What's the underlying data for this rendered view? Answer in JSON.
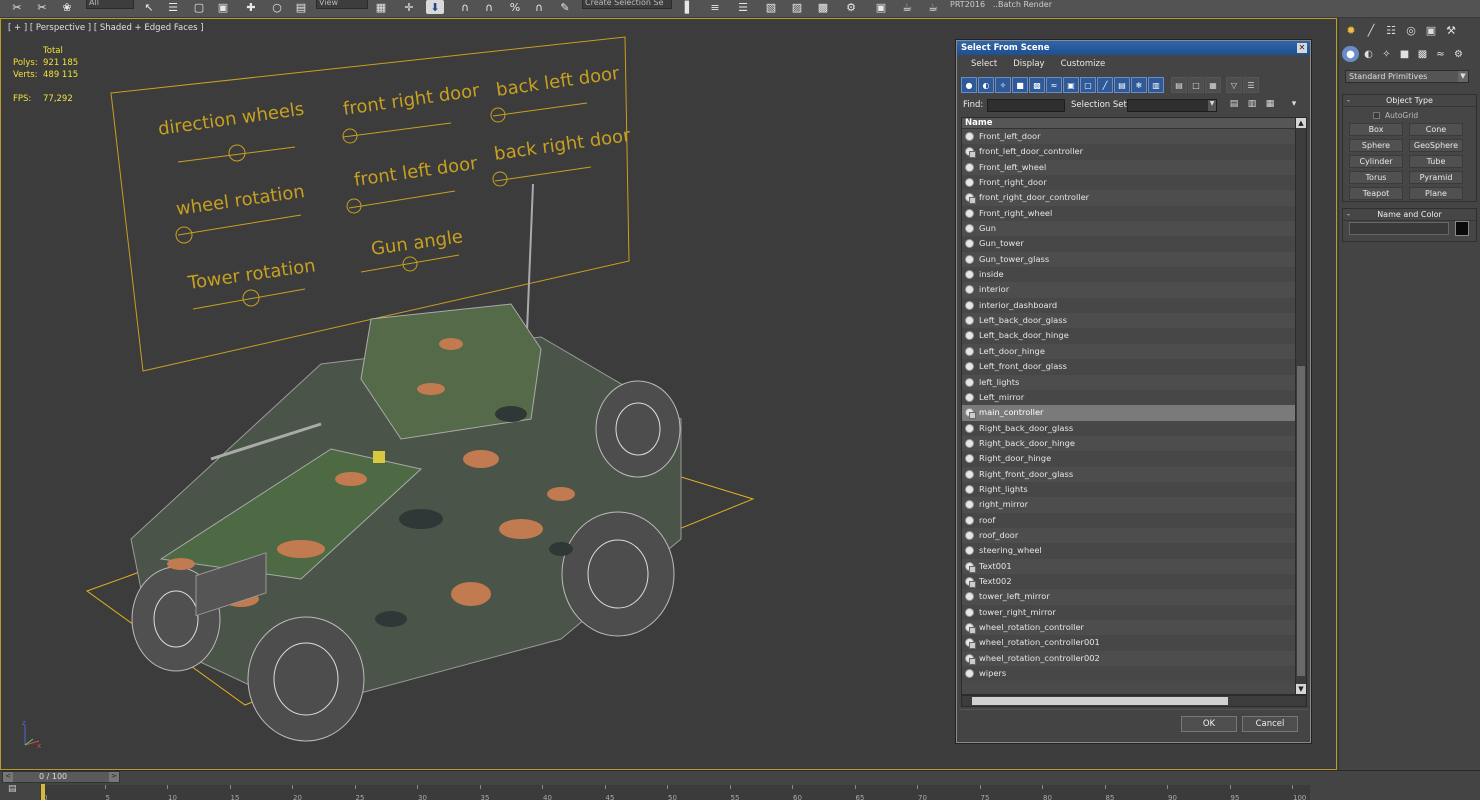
{
  "toolbar": {
    "filter_value": "All",
    "refcoord_value": "View",
    "named_selection": "Create Selection Se",
    "plugin_label": "PRT2016",
    "batch_render": "Batch Render..."
  },
  "viewport": {
    "label": "[ + ] [ Perspective ] [ Shaded + Edged Faces ]",
    "stats": {
      "total_label": "Total",
      "polys_label": "Polys:",
      "polys_value": "921 185",
      "verts_label": "Verts:",
      "verts_value": "489 115",
      "fps_label": "FPS:",
      "fps_value": "77,292"
    },
    "panel_labels": {
      "direction_wheels": "direction wheels",
      "front_right_door": "front right door",
      "back_left_door": "back left door",
      "wheel_rotation": "wheel rotation",
      "front_left_door": "front left door",
      "back_right_door": "back right door",
      "tower_rotation": "Tower rotation",
      "gun_angle": "Gun angle"
    },
    "colors": {
      "panel": "#c8a020",
      "selection": "#e0b020",
      "wire": "#bdbdbd",
      "camo_green": "#5e7a4a",
      "camo_orange": "#c27a50",
      "camo_dark": "#3c4640"
    }
  },
  "command_panel": {
    "primitive_type": "Standard Primitives",
    "object_type_title": "Object Type",
    "autogrid_label": "AutoGrid",
    "buttons": [
      "Box",
      "Cone",
      "Sphere",
      "GeoSphere",
      "Cylinder",
      "Tube",
      "Torus",
      "Pyramid",
      "Teapot",
      "Plane"
    ],
    "name_color_title": "Name and Color"
  },
  "dialog": {
    "title": "Select From Scene",
    "menu": [
      "Select",
      "Display",
      "Customize"
    ],
    "find_label": "Find:",
    "selection_set_label": "Selection Set:",
    "column_header": "Name",
    "items": [
      {
        "name": "Front_left_door",
        "helper": false
      },
      {
        "name": "front_left_door_controller",
        "helper": true
      },
      {
        "name": "Front_left_wheel",
        "helper": false
      },
      {
        "name": "Front_right_door",
        "helper": false
      },
      {
        "name": "front_right_door_controller",
        "helper": true
      },
      {
        "name": "Front_right_wheel",
        "helper": false
      },
      {
        "name": "Gun",
        "helper": false
      },
      {
        "name": "Gun_tower",
        "helper": false
      },
      {
        "name": "Gun_tower_glass",
        "helper": false
      },
      {
        "name": "inside",
        "helper": false
      },
      {
        "name": "interior",
        "helper": false
      },
      {
        "name": "interior_dashboard",
        "helper": false
      },
      {
        "name": "Left_back_door_glass",
        "helper": false
      },
      {
        "name": "Left_back_door_hinge",
        "helper": false
      },
      {
        "name": "Left_door_hinge",
        "helper": false
      },
      {
        "name": "Left_front_door_glass",
        "helper": false
      },
      {
        "name": "left_lights",
        "helper": false
      },
      {
        "name": "Left_mirror",
        "helper": false
      },
      {
        "name": "main_controller",
        "helper": true,
        "selected": true
      },
      {
        "name": "Right_back_door_glass",
        "helper": false
      },
      {
        "name": "Right_back_door_hinge",
        "helper": false
      },
      {
        "name": "Right_door_hinge",
        "helper": false
      },
      {
        "name": "Right_front_door_glass",
        "helper": false
      },
      {
        "name": "Right_lights",
        "helper": false
      },
      {
        "name": "right_mirror",
        "helper": false
      },
      {
        "name": "roof",
        "helper": false
      },
      {
        "name": "roof_door",
        "helper": false
      },
      {
        "name": "steering_wheel",
        "helper": false
      },
      {
        "name": "Text001",
        "helper": true
      },
      {
        "name": "Text002",
        "helper": true
      },
      {
        "name": "tower_left_mirror",
        "helper": false
      },
      {
        "name": "tower_right_mirror",
        "helper": false
      },
      {
        "name": "wheel_rotation_controller",
        "helper": true
      },
      {
        "name": "wheel_rotation_controller001",
        "helper": true
      },
      {
        "name": "wheel_rotation_controller002",
        "helper": true
      },
      {
        "name": "wipers",
        "helper": false
      }
    ],
    "ok_label": "OK",
    "cancel_label": "Cancel"
  },
  "timeline": {
    "frame_label": "0 / 100",
    "ticks": [
      "0",
      "5",
      "10",
      "15",
      "20",
      "25",
      "30",
      "35",
      "40",
      "45",
      "50",
      "55",
      "60",
      "65",
      "70",
      "75",
      "80",
      "85",
      "90",
      "95",
      "100"
    ]
  }
}
